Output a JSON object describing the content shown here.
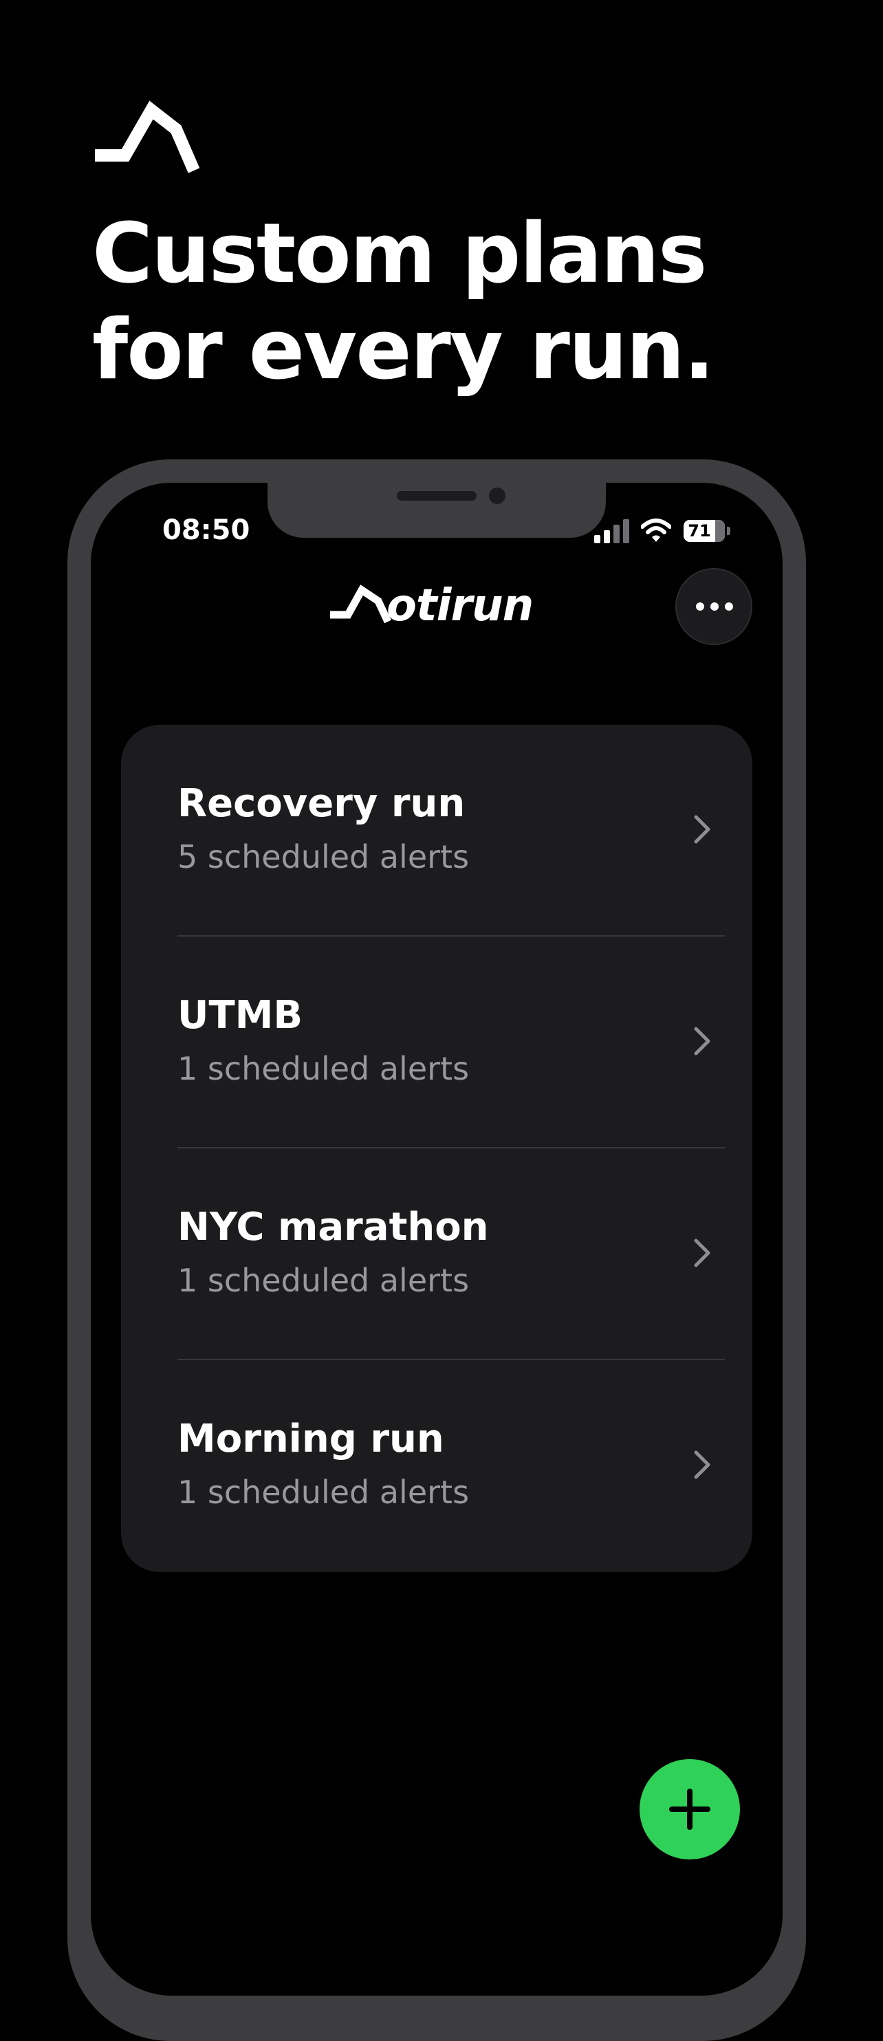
{
  "promo": {
    "headline_line1": "Custom plans",
    "headline_line2": "for every run."
  },
  "status_bar": {
    "time": "08:50",
    "battery_level": "71"
  },
  "app": {
    "brand_name": "otirun"
  },
  "plans": [
    {
      "title": "Recovery run",
      "subtitle": "5 scheduled alerts"
    },
    {
      "title": "UTMB",
      "subtitle": "1 scheduled alerts"
    },
    {
      "title": "NYC marathon",
      "subtitle": "1 scheduled alerts"
    },
    {
      "title": "Morning run",
      "subtitle": "1 scheduled alerts"
    }
  ],
  "colors": {
    "background": "#000000",
    "frame": "#3d3d3f",
    "card": "#1c1c1e",
    "secondary_text": "#98989d",
    "accent": "#30d158"
  },
  "icons": {
    "brand": "motirun-m-logo",
    "more": "ellipsis-icon",
    "row": "chevron-right-icon",
    "add": "plus-icon"
  }
}
